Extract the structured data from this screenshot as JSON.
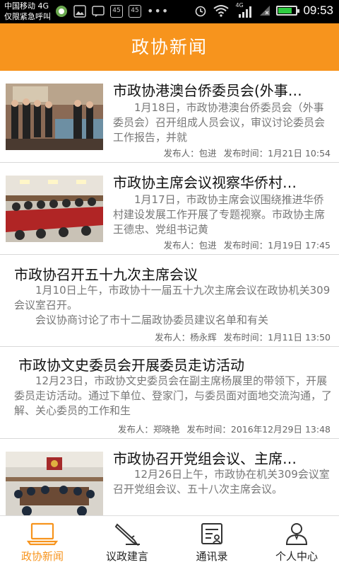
{
  "status_bar": {
    "carrier_line1": "中国移动 4G",
    "carrier_line2": "仅限紧急呼叫",
    "badge1": "45",
    "badge2": "45",
    "network": "4G",
    "time": "09:53",
    "battery_level": 0.8
  },
  "header": {
    "title": "政协新闻"
  },
  "news": [
    {
      "title": "市政协港澳台侨委员会(外事…",
      "summary": "1月18日，市政协港澳台侨委员会（外事委员会）召开组成人员会议，审议讨论委员会工作报告，并就",
      "publisher_label": "发布人：包进",
      "time_label": "发布时间：1月21日 10:54"
    },
    {
      "title": "市政协主席会议视察华侨村…",
      "summary": "1月17日，市政协主席会议围绕推进华侨村建设发展工作开展了专题视察。市政协主席王德忠、党组书记黄",
      "publisher_label": "发布人：包进",
      "time_label": "发布时间：1月19日 17:45"
    },
    {
      "title": "市政协召开五十九次主席会议",
      "summary": "1月10日上午，市政协十一届五十九次主席会议在政协机关309会议室召开。",
      "summary2": "会议协商讨论了市十二届政协委员建议名单和有关",
      "publisher_label": "发布人：杨永辉",
      "time_label": "发布时间：1月11日 13:50"
    },
    {
      "title": "市政协文史委员会开展委员走访活动",
      "summary": "12月23日，市政协文史委员会在副主席杨展里的带领下，开展委员走访活动。通过下单位、登家门，与委员面对面地交流沟通，了解、关心委员的工作和生",
      "publisher_label": "发布人：郑晓艳",
      "time_label": "发布时间：2016年12月29日 13:48"
    },
    {
      "title": "市政协召开党组会议、主席…",
      "summary": "12月26日上午，市政协在机关309会议室召开党组会议、五十八次主席会议。",
      "publisher_label": "",
      "time_label": ""
    }
  ],
  "tabs": [
    {
      "label": "政协新闻",
      "icon": "laptop-icon",
      "active": true
    },
    {
      "label": "议政建言",
      "icon": "pencil-icon",
      "active": false
    },
    {
      "label": "通讯录",
      "icon": "contacts-card-icon",
      "active": false
    },
    {
      "label": "个人中心",
      "icon": "person-icon",
      "active": false
    }
  ],
  "colors": {
    "accent": "#f7941d",
    "background": "#f2f2f2"
  }
}
